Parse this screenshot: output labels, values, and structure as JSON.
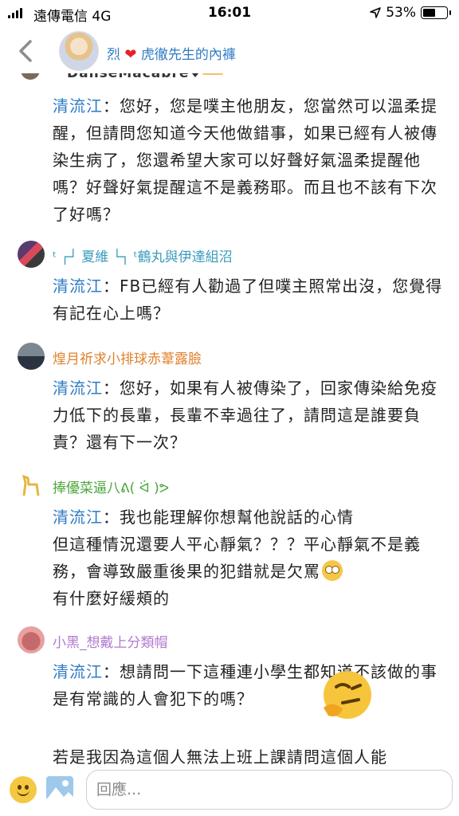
{
  "status_bar": {
    "carrier": "遠傳電信  4G",
    "time": "16:01",
    "battery": "53%",
    "battery_level": 0.53
  },
  "header": {
    "title_prefix": "烈",
    "title_suffix": "虎徹先生的內褲"
  },
  "comments": [
    {
      "name": "",
      "mention": "清流江",
      "text": "：您好，您是噗主他朋友，您當然可以溫柔提醒，但請問您知道今天他做錯事，如果已經有人被傳染生病了，您還希望大家可以好聲好氣溫柔提醒他嗎？好聲好氣提醒這不是義務耶。而且也不該有下次了好嗎？"
    },
    {
      "name": "ᵗ ┌┘ 夏維 └┐ ᵗ鶴丸與伊達組沼",
      "mention": "清流江",
      "text": "：FB已經有人勸過了但噗主照常出沒，您覺得有記在心上嗎？"
    },
    {
      "name": "煌月祈求小排球赤葦露臉",
      "mention": "清流江",
      "text": "：您好，如果有人被傳染了，回家傳染給免疫力低下的長輩，長輩不幸過往了，請問這是誰要負責？還有下一次？"
    },
    {
      "name": "捧優菜逼八ᕕ( ᐛ )ᕗ",
      "mention": "清流江",
      "text": "：我也能理解你想幫他說話的心情\n但這種情況還要人平心靜氣？？？平心靜氣不是義務，會導致嚴重後果的犯錯就是欠罵",
      "text_after_emoji": "\n有什麼好緩頰的"
    },
    {
      "name": "小黑_想戴上分類帽",
      "mention": "清流江",
      "text": "：想請問一下這種連小學生都知道不該做的事是有常識的人會犯下的嗎？",
      "text_bottom": "若是我因為這個人無法上班上課請問這個人能"
    }
  ],
  "colors": {
    "link_blue": "#2f7cc4",
    "name_teal": "#3a9bbd",
    "name_orange": "#e0822e",
    "name_green": "#4aa63a",
    "name_purple": "#b07ad0"
  },
  "reply": {
    "placeholder": "回應..."
  },
  "icons": {
    "back": "chevron-left-icon",
    "smile": "smiley-icon",
    "image": "image-icon",
    "location": "location-arrow-icon"
  }
}
